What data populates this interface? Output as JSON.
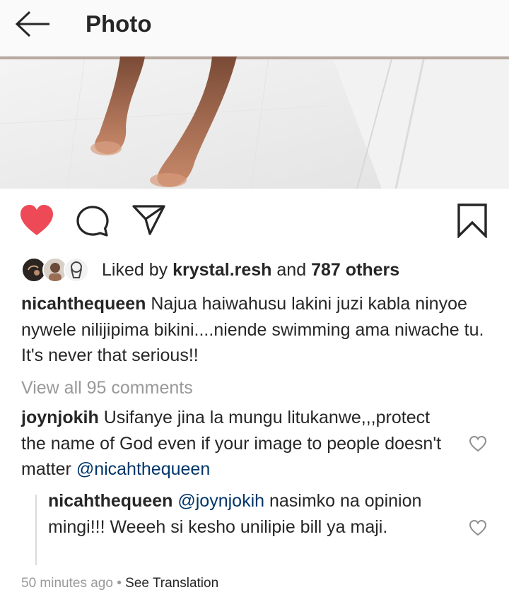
{
  "header": {
    "title": "Photo"
  },
  "post": {
    "liked_by": {
      "prefix": "Liked by",
      "user": "krystal.resh",
      "joiner": "and",
      "others": "787 others"
    },
    "caption": {
      "username": "nicahthequeen",
      "text": "Najua haiwahusu lakini juzi kabla ninyoe nywele nilijipima bikini....niende swimming ama niwache tu. It's never that serious!!"
    },
    "view_all_comments": "View all 95 comments",
    "comments": [
      {
        "username": "joynjokih",
        "text": "Usifanye jina la mungu litukanwe,,,protect the name of God even if your image to people doesn't matter",
        "mention": "@nicahthequeen"
      }
    ],
    "reply": {
      "username": "nicahthequeen",
      "mention": "@joynjokih",
      "text": "nasimko na opinion mingi!!! Weeeh si kesho unilipie bill ya maji."
    },
    "time_ago": "50 minutes ago",
    "separator": "•",
    "see_translation": "See Translation"
  },
  "colors": {
    "like_active": "#ed4956",
    "mention": "#003569",
    "muted": "#999999"
  },
  "icons": {
    "back": "arrow-left-icon",
    "like": "heart-filled-icon",
    "comment": "speech-bubble-icon",
    "share": "paper-plane-icon",
    "save": "bookmark-icon",
    "comment_like": "heart-outline-icon"
  }
}
